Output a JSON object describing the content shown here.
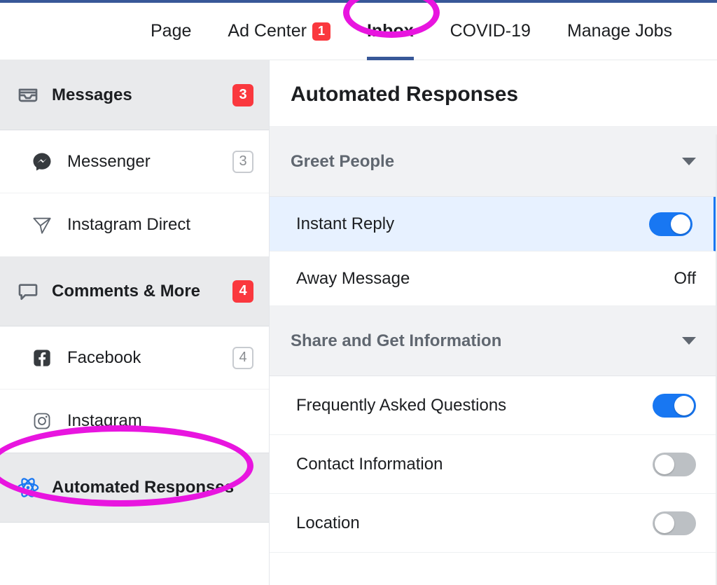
{
  "topnav": {
    "page": "Page",
    "ad_center": {
      "label": "Ad Center",
      "badge": "1"
    },
    "inbox": "Inbox",
    "covid": "COVID-19",
    "manage_jobs": "Manage Jobs"
  },
  "sidebar": {
    "messages": {
      "label": "Messages",
      "badge": "3"
    },
    "messenger": {
      "label": "Messenger",
      "badge": "3"
    },
    "instagram_direct": {
      "label": "Instagram Direct"
    },
    "comments_more": {
      "label": "Comments & More",
      "badge": "4"
    },
    "facebook": {
      "label": "Facebook",
      "badge": "4"
    },
    "instagram": {
      "label": "Instagram"
    },
    "automated_responses": {
      "label": "Automated Responses"
    }
  },
  "main": {
    "title": "Automated Responses",
    "groups": [
      {
        "title": "Greet People",
        "items": [
          {
            "label": "Instant Reply",
            "state": "on",
            "selected": true
          },
          {
            "label": "Away Message",
            "state_text": "Off"
          }
        ]
      },
      {
        "title": "Share and Get Information",
        "items": [
          {
            "label": "Frequently Asked Questions",
            "state": "on"
          },
          {
            "label": "Contact Information",
            "state": "off"
          },
          {
            "label": "Location",
            "state": "off"
          }
        ]
      }
    ]
  }
}
